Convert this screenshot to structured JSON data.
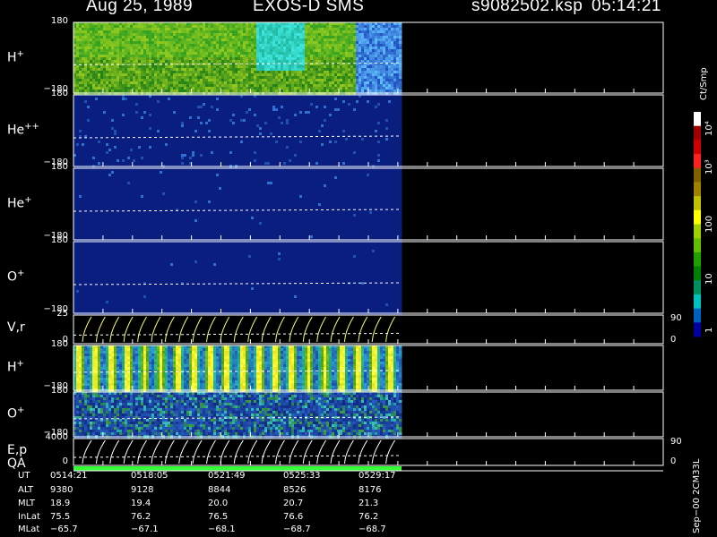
{
  "header": {
    "date": "Aug 25, 1989",
    "mission": "EXOS-D SMS",
    "file": "s9082502.ksp",
    "time": "05:14:21"
  },
  "chart_data": {
    "type": "heatmap",
    "panels": [
      {
        "id": "h",
        "ion": "H",
        "charge": "+",
        "ymax": "180",
        "ymin": "−180",
        "kind": "heat",
        "scheme": "green"
      },
      {
        "id": "hepp",
        "ion": "He",
        "charge": "++",
        "ymax": "180",
        "ymin": "−180",
        "kind": "heat",
        "scheme": "navy"
      },
      {
        "id": "hep",
        "ion": "He",
        "charge": "+",
        "ymax": "180",
        "ymin": "−180",
        "kind": "heat",
        "scheme": "navyclean"
      },
      {
        "id": "op",
        "ion": "O",
        "charge": "+",
        "ymax": "180",
        "ymin": "−180",
        "kind": "heat",
        "scheme": "navyclean"
      },
      {
        "id": "vr",
        "ion": "V,r",
        "charge": "",
        "ymax": "25",
        "ymin": "0",
        "right_top": "90",
        "right_bottom": "0",
        "kind": "line",
        "color": "#ffff66"
      },
      {
        "id": "h2",
        "ion": "H",
        "charge": "+",
        "ymax": "180",
        "ymin": "−180",
        "kind": "heat",
        "scheme": "stripe"
      },
      {
        "id": "o2",
        "ion": "O",
        "charge": "+",
        "ymax": "180",
        "ymin": "−180",
        "kind": "heat",
        "scheme": "mixed"
      },
      {
        "id": "ep",
        "ion": "E,p",
        "charge": "",
        "ymax": "4000",
        "ymin": "0",
        "right_top": "90",
        "right_bottom": "0",
        "kind": "line",
        "color": "#ffffff"
      }
    ],
    "qa_label": "QA",
    "colorbar": {
      "unit": "Ct/Smp",
      "ticks": [
        "10⁴",
        "10³",
        "100",
        "10",
        "1"
      ],
      "colors": [
        "#ffffff",
        "#a00000",
        "#d00000",
        "#ff2020",
        "#806000",
        "#a08000",
        "#c0c000",
        "#ffff00",
        "#a0d000",
        "#60c000",
        "#20a000",
        "#008000",
        "#009060",
        "#00c0c0",
        "#0060c0",
        "#0000a0"
      ]
    },
    "time_table": {
      "labels": [
        "UT",
        "ALT",
        "MLT",
        "InLat",
        "MLat"
      ],
      "columns": [
        [
          "0514:21",
          "9380",
          "18.9",
          "75.5",
          "−65.7"
        ],
        [
          "0518:05",
          "9128",
          "19.4",
          "76.2",
          "−67.1"
        ],
        [
          "0521:49",
          "8844",
          "20.0",
          "76.5",
          "−68.1"
        ],
        [
          "0525:33",
          "8526",
          "20.7",
          "76.6",
          "−68.7"
        ],
        [
          "0529:17",
          "8176",
          "21.3",
          "76.2",
          "−68.7"
        ]
      ]
    },
    "footer": "Sep−00 2CM33L",
    "colors": {
      "background": "#000000",
      "axis": "#ffffff",
      "navy": "#0a1e80",
      "qa_bar": "#33ff33"
    }
  }
}
